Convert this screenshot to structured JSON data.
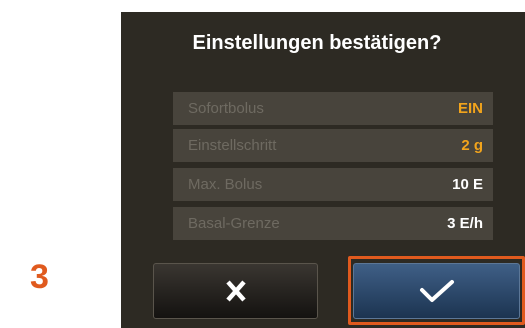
{
  "step_number": "3",
  "dialog": {
    "title": "Einstellungen bestätigen?",
    "rows": [
      {
        "label": "Sofortbolus",
        "value": "EIN"
      },
      {
        "label": "Einstellschritt",
        "value": "2 g"
      },
      {
        "label": "Max. Bolus",
        "value": "10 E"
      },
      {
        "label": "Basal-Grenze",
        "value": "3 E/h"
      }
    ],
    "cancel_icon": "close-icon",
    "confirm_icon": "checkmark-icon"
  },
  "colors": {
    "accent_value": "#f2a41c",
    "highlight_frame": "#e05a1e",
    "screen_background": "#2d2a23",
    "confirm_button": "#2b4a70"
  }
}
